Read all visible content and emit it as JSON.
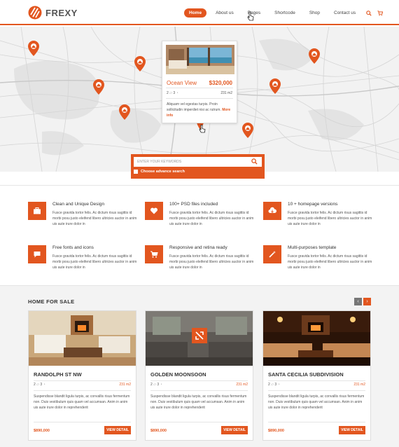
{
  "brand": {
    "name": "FREXY",
    "accent": "#e2561f"
  },
  "nav": {
    "items": [
      {
        "label": "Home",
        "active": true
      },
      {
        "label": "About us",
        "active": false
      },
      {
        "label": "Pages",
        "active": false
      },
      {
        "label": "Shortcode",
        "active": false
      },
      {
        "label": "Shop",
        "active": false
      },
      {
        "label": "Contact us",
        "active": false
      }
    ],
    "icons": [
      "search-icon",
      "cart-icon"
    ]
  },
  "map_card": {
    "title": "Ocean View",
    "price": "$320,000",
    "beds": "2",
    "baths": "3",
    "area": "231 m2",
    "description": "Aliquam vel egestas turpis. Proin sollicitudin imperdiet nisi ac rutrum.",
    "more": "More info"
  },
  "search": {
    "placeholder": "ENTER YOUR KEYWORDS",
    "advance_label": "Choose advance search"
  },
  "features": [
    {
      "title": "Clean and Unique Design",
      "icon": "briefcase-icon",
      "text": "Fusce gravida tortor felis. Ac dictum risus sagittis id morbi posu justo eleifend libero ultricies auctor in anim uis aute irure dolor in"
    },
    {
      "title": "100+ PSD files included",
      "icon": "heart-icon",
      "text": "Fusce gravida tortor felis. Ac dictum risus sagittis id morbi posu justo eleifend libero ultricies auctor in anim uis aute irure dolor in"
    },
    {
      "title": "10 + homepage versions",
      "icon": "cloud-download-icon",
      "text": "Fusce gravida tortor felis. Ac dictum risus sagittis id morbi posu justo eleifend libero ultricies auctor in anim uis aute irure dolor in"
    },
    {
      "title": "Free fonts and icons",
      "icon": "chat-icon",
      "text": "Fusce gravida tortor felis. Ac dictum risus sagittis id morbi posu justo eleifend libero ultricies auctor in anim uis aute irure dolor in"
    },
    {
      "title": "Responsive and retina ready",
      "icon": "cart-icon",
      "text": "Fusce gravida tortor felis. Ac dictum risus sagittis id morbi posu justo eleifend libero ultricies auctor in anim uis aute irure dolor in"
    },
    {
      "title": "Multi-purposes template",
      "icon": "magic-wand-icon",
      "text": "Fusce gravida tortor felis. Ac dictum risus sagittis id morbi posu justo eleifend libero ultricies auctor in anim uis aute irure dolor in"
    }
  ],
  "sale": {
    "title": "HOME FOR SALE",
    "prev": "‹",
    "next": "›",
    "cards": [
      {
        "name": "RANDOLPH ST NW",
        "beds": "2",
        "baths": "3",
        "area": "231 m2",
        "description": "Suspendisse blandit ligula turpis, ac convallis risus fermentum non. Duis vestibulum quis quam vel accumsan. Anim in anim uis aute irure dolor in reprehenderit",
        "price": "$890,000",
        "button": "VIEW DETAIL"
      },
      {
        "name": "GOLDEN MOONSOON",
        "beds": "2",
        "baths": "3",
        "area": "231 m2",
        "description": "Suspendisse blandit ligula turpis, ac convallis risus fermentum non. Duis vestibulum quis quam vel accumsan. Anim in anim uis aute irure dolor in reprehenderit",
        "price": "$890,000",
        "button": "VIEW DETAIL"
      },
      {
        "name": "SANTA CECILIA SUBDIVISION",
        "beds": "2",
        "baths": "3",
        "area": "231 m2",
        "description": "Suspendisse blandit ligula turpis, ac convallis risus fermentum non. Duis vestibulum quis quam vel accumsan. Anim in anim uis aute irure dolor in reprehenderit",
        "price": "$890,000",
        "button": "VIEW DETAIL"
      }
    ]
  }
}
